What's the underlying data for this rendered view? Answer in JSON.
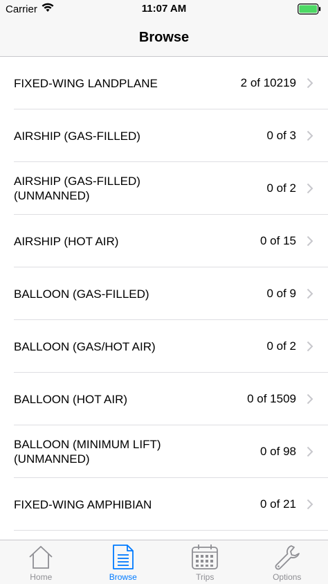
{
  "status_bar": {
    "carrier": "Carrier",
    "time": "11:07 AM",
    "battery_color": "#4cd964"
  },
  "nav": {
    "title": "Browse"
  },
  "list": {
    "items": [
      {
        "label": "FIXED-WING LANDPLANE",
        "count": "2 of 10219"
      },
      {
        "label": "AIRSHIP (GAS-FILLED)",
        "count": "0 of 3"
      },
      {
        "label": "AIRSHIP (GAS-FILLED)\n(UNMANNED)",
        "count": "0 of 2"
      },
      {
        "label": "AIRSHIP (HOT AIR)",
        "count": "0 of 15"
      },
      {
        "label": "BALLOON (GAS-FILLED)",
        "count": "0 of 9"
      },
      {
        "label": "BALLOON (GAS/HOT AIR)",
        "count": "0 of 2"
      },
      {
        "label": "BALLOON (HOT AIR)",
        "count": "0 of 1509"
      },
      {
        "label": "BALLOON (MINIMUM LIFT)\n(UNMANNED)",
        "count": "0 of 98"
      },
      {
        "label": "FIXED-WING AMPHIBIAN",
        "count": "0 of 21"
      },
      {
        "label": "",
        "count": ""
      }
    ]
  },
  "tab_bar": {
    "tabs": [
      {
        "label": "Home",
        "icon": "home-icon",
        "active": false
      },
      {
        "label": "Browse",
        "icon": "document-icon",
        "active": true
      },
      {
        "label": "Trips",
        "icon": "calendar-icon",
        "active": false
      },
      {
        "label": "Options",
        "icon": "wrench-icon",
        "active": false
      }
    ],
    "active_color": "#007aff",
    "inactive_color": "#8e8e93"
  }
}
